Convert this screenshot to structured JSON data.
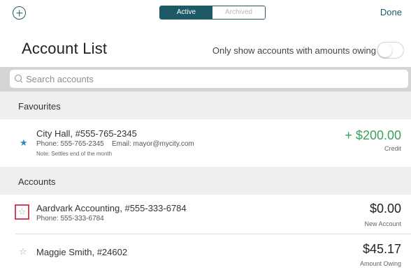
{
  "topbar": {
    "add_icon": "plus-circle-icon",
    "tabs": [
      {
        "label": "Active",
        "selected": true
      },
      {
        "label": "Archived",
        "selected": false
      }
    ],
    "done_label": "Done"
  },
  "header": {
    "title": "Account List",
    "filter_label": "Only show accounts with amounts owing",
    "filter_on": false
  },
  "search": {
    "placeholder": "Search accounts",
    "value": ""
  },
  "favourites": {
    "title": "Favourites",
    "items": [
      {
        "title": "City Hall, #555-765-2345",
        "phone": "Phone: 555-765-2345",
        "email": "Email: mayor@mycity.com",
        "note": "Note: Settles end of the month",
        "amount": "+ $200.00",
        "amount_label": "Credit",
        "starred": true
      }
    ]
  },
  "accounts": {
    "title": "Accounts",
    "items": [
      {
        "title": "Aardvark Accounting, #555-333-6784",
        "phone": "Phone: 555-333-6784",
        "amount": "$0.00",
        "amount_label": "New Account",
        "starred": false
      },
      {
        "title": "Maggie Smith, #24602",
        "amount": "$45.17",
        "amount_label": "Amount Owing",
        "starred": false
      }
    ]
  },
  "colors": {
    "accent": "#1e5a66",
    "credit_green": "#3aa15a",
    "star_blue": "#2a8cb6",
    "highlight_red": "#d04455"
  }
}
